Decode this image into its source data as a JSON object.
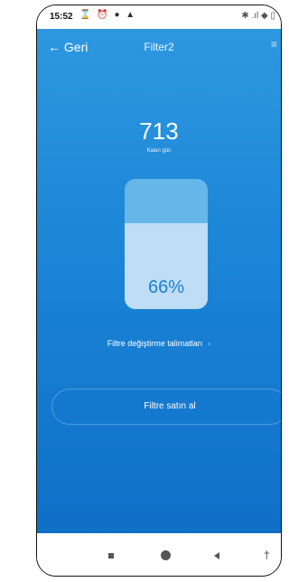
{
  "status_bar": {
    "time": "15:52",
    "icons": "⌛ ⏰ ● ▲",
    "right": "✱ .ıl ◆ ▯"
  },
  "header": {
    "back_label": "← Geri",
    "title": "Filter2",
    "menu": "≡"
  },
  "filter": {
    "days_remaining": "713",
    "days_label": "Kalan gün",
    "level_percent": 66,
    "level_text": "66%"
  },
  "instructions_link": {
    "label": "Filtre değiştirme talimatları",
    "chevron": "›"
  },
  "buy_button": {
    "label": "Filtre satın al"
  },
  "nav_bar": {
    "accessibility": "†"
  },
  "colors": {
    "app_bg_top": "#2d98e0",
    "app_bg_bottom": "#0f6fc8",
    "gauge_empty": "#66b6ea",
    "gauge_fill": "#bfdef5",
    "gauge_text": "#1d7ecf"
  }
}
